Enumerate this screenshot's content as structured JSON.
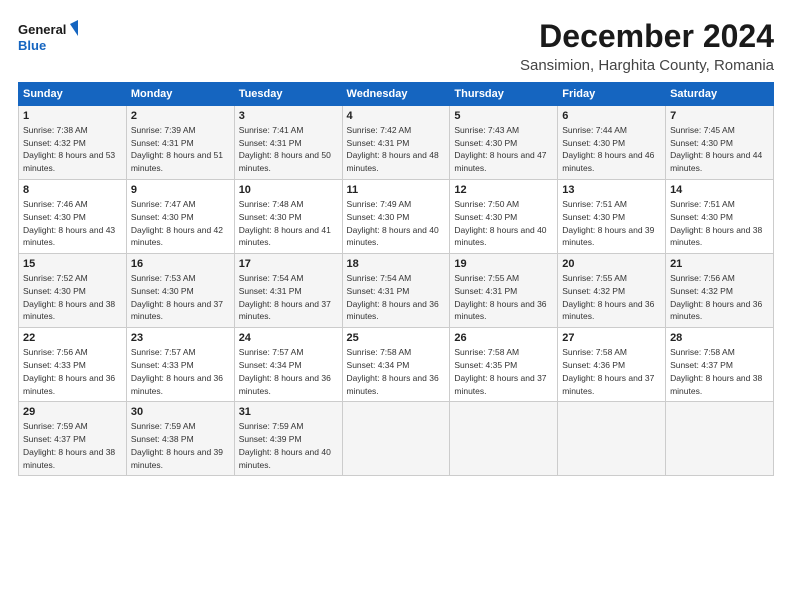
{
  "logo": {
    "line1": "General",
    "line2": "Blue"
  },
  "title": "December 2024",
  "subtitle": "Sansimion, Harghita County, Romania",
  "headers": [
    "Sunday",
    "Monday",
    "Tuesday",
    "Wednesday",
    "Thursday",
    "Friday",
    "Saturday"
  ],
  "weeks": [
    [
      {
        "day": "1",
        "sunrise": "Sunrise: 7:38 AM",
        "sunset": "Sunset: 4:32 PM",
        "daylight": "Daylight: 8 hours and 53 minutes."
      },
      {
        "day": "2",
        "sunrise": "Sunrise: 7:39 AM",
        "sunset": "Sunset: 4:31 PM",
        "daylight": "Daylight: 8 hours and 51 minutes."
      },
      {
        "day": "3",
        "sunrise": "Sunrise: 7:41 AM",
        "sunset": "Sunset: 4:31 PM",
        "daylight": "Daylight: 8 hours and 50 minutes."
      },
      {
        "day": "4",
        "sunrise": "Sunrise: 7:42 AM",
        "sunset": "Sunset: 4:31 PM",
        "daylight": "Daylight: 8 hours and 48 minutes."
      },
      {
        "day": "5",
        "sunrise": "Sunrise: 7:43 AM",
        "sunset": "Sunset: 4:30 PM",
        "daylight": "Daylight: 8 hours and 47 minutes."
      },
      {
        "day": "6",
        "sunrise": "Sunrise: 7:44 AM",
        "sunset": "Sunset: 4:30 PM",
        "daylight": "Daylight: 8 hours and 46 minutes."
      },
      {
        "day": "7",
        "sunrise": "Sunrise: 7:45 AM",
        "sunset": "Sunset: 4:30 PM",
        "daylight": "Daylight: 8 hours and 44 minutes."
      }
    ],
    [
      {
        "day": "8",
        "sunrise": "Sunrise: 7:46 AM",
        "sunset": "Sunset: 4:30 PM",
        "daylight": "Daylight: 8 hours and 43 minutes."
      },
      {
        "day": "9",
        "sunrise": "Sunrise: 7:47 AM",
        "sunset": "Sunset: 4:30 PM",
        "daylight": "Daylight: 8 hours and 42 minutes."
      },
      {
        "day": "10",
        "sunrise": "Sunrise: 7:48 AM",
        "sunset": "Sunset: 4:30 PM",
        "daylight": "Daylight: 8 hours and 41 minutes."
      },
      {
        "day": "11",
        "sunrise": "Sunrise: 7:49 AM",
        "sunset": "Sunset: 4:30 PM",
        "daylight": "Daylight: 8 hours and 40 minutes."
      },
      {
        "day": "12",
        "sunrise": "Sunrise: 7:50 AM",
        "sunset": "Sunset: 4:30 PM",
        "daylight": "Daylight: 8 hours and 40 minutes."
      },
      {
        "day": "13",
        "sunrise": "Sunrise: 7:51 AM",
        "sunset": "Sunset: 4:30 PM",
        "daylight": "Daylight: 8 hours and 39 minutes."
      },
      {
        "day": "14",
        "sunrise": "Sunrise: 7:51 AM",
        "sunset": "Sunset: 4:30 PM",
        "daylight": "Daylight: 8 hours and 38 minutes."
      }
    ],
    [
      {
        "day": "15",
        "sunrise": "Sunrise: 7:52 AM",
        "sunset": "Sunset: 4:30 PM",
        "daylight": "Daylight: 8 hours and 38 minutes."
      },
      {
        "day": "16",
        "sunrise": "Sunrise: 7:53 AM",
        "sunset": "Sunset: 4:30 PM",
        "daylight": "Daylight: 8 hours and 37 minutes."
      },
      {
        "day": "17",
        "sunrise": "Sunrise: 7:54 AM",
        "sunset": "Sunset: 4:31 PM",
        "daylight": "Daylight: 8 hours and 37 minutes."
      },
      {
        "day": "18",
        "sunrise": "Sunrise: 7:54 AM",
        "sunset": "Sunset: 4:31 PM",
        "daylight": "Daylight: 8 hours and 36 minutes."
      },
      {
        "day": "19",
        "sunrise": "Sunrise: 7:55 AM",
        "sunset": "Sunset: 4:31 PM",
        "daylight": "Daylight: 8 hours and 36 minutes."
      },
      {
        "day": "20",
        "sunrise": "Sunrise: 7:55 AM",
        "sunset": "Sunset: 4:32 PM",
        "daylight": "Daylight: 8 hours and 36 minutes."
      },
      {
        "day": "21",
        "sunrise": "Sunrise: 7:56 AM",
        "sunset": "Sunset: 4:32 PM",
        "daylight": "Daylight: 8 hours and 36 minutes."
      }
    ],
    [
      {
        "day": "22",
        "sunrise": "Sunrise: 7:56 AM",
        "sunset": "Sunset: 4:33 PM",
        "daylight": "Daylight: 8 hours and 36 minutes."
      },
      {
        "day": "23",
        "sunrise": "Sunrise: 7:57 AM",
        "sunset": "Sunset: 4:33 PM",
        "daylight": "Daylight: 8 hours and 36 minutes."
      },
      {
        "day": "24",
        "sunrise": "Sunrise: 7:57 AM",
        "sunset": "Sunset: 4:34 PM",
        "daylight": "Daylight: 8 hours and 36 minutes."
      },
      {
        "day": "25",
        "sunrise": "Sunrise: 7:58 AM",
        "sunset": "Sunset: 4:34 PM",
        "daylight": "Daylight: 8 hours and 36 minutes."
      },
      {
        "day": "26",
        "sunrise": "Sunrise: 7:58 AM",
        "sunset": "Sunset: 4:35 PM",
        "daylight": "Daylight: 8 hours and 37 minutes."
      },
      {
        "day": "27",
        "sunrise": "Sunrise: 7:58 AM",
        "sunset": "Sunset: 4:36 PM",
        "daylight": "Daylight: 8 hours and 37 minutes."
      },
      {
        "day": "28",
        "sunrise": "Sunrise: 7:58 AM",
        "sunset": "Sunset: 4:37 PM",
        "daylight": "Daylight: 8 hours and 38 minutes."
      }
    ],
    [
      {
        "day": "29",
        "sunrise": "Sunrise: 7:59 AM",
        "sunset": "Sunset: 4:37 PM",
        "daylight": "Daylight: 8 hours and 38 minutes."
      },
      {
        "day": "30",
        "sunrise": "Sunrise: 7:59 AM",
        "sunset": "Sunset: 4:38 PM",
        "daylight": "Daylight: 8 hours and 39 minutes."
      },
      {
        "day": "31",
        "sunrise": "Sunrise: 7:59 AM",
        "sunset": "Sunset: 4:39 PM",
        "daylight": "Daylight: 8 hours and 40 minutes."
      },
      null,
      null,
      null,
      null
    ]
  ]
}
